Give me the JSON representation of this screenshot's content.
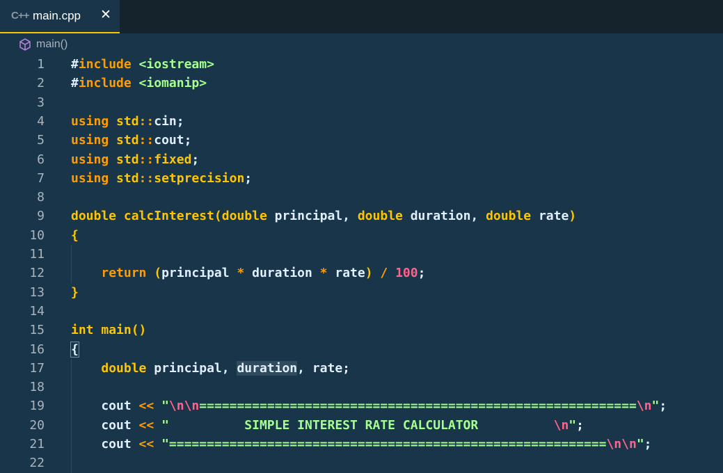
{
  "tab": {
    "icon": "cpp-file-icon",
    "icon_text": "C++",
    "label": "main.cpp",
    "close": "✕"
  },
  "breadcrumb": {
    "icon": "cube-icon",
    "label": "main()"
  },
  "colors": {
    "background": "#193549",
    "tabbar": "#15232d",
    "accent": "#ffc600",
    "keyword": "#ff9d00",
    "string": "#a5ff90",
    "escape": "#ff628c"
  },
  "editor": {
    "lines": [
      {
        "n": "1",
        "tokens": [
          [
            "pu",
            "#"
          ],
          [
            "kw",
            "include"
          ],
          [
            "pu",
            " "
          ],
          [
            "str",
            "<iostream>"
          ]
        ]
      },
      {
        "n": "2",
        "tokens": [
          [
            "pu",
            "#"
          ],
          [
            "kw",
            "include"
          ],
          [
            "pu",
            " "
          ],
          [
            "str",
            "<iomanip>"
          ]
        ]
      },
      {
        "n": "3",
        "tokens": []
      },
      {
        "n": "4",
        "tokens": [
          [
            "kw",
            "using"
          ],
          [
            "pu",
            " "
          ],
          [
            "ns",
            "std"
          ],
          [
            "op",
            "::"
          ],
          [
            "pu",
            "cin;"
          ]
        ]
      },
      {
        "n": "5",
        "tokens": [
          [
            "kw",
            "using"
          ],
          [
            "pu",
            " "
          ],
          [
            "ns",
            "std"
          ],
          [
            "op",
            "::"
          ],
          [
            "pu",
            "cout;"
          ]
        ]
      },
      {
        "n": "6",
        "tokens": [
          [
            "kw",
            "using"
          ],
          [
            "pu",
            " "
          ],
          [
            "ns",
            "std"
          ],
          [
            "op",
            "::"
          ],
          [
            "ns",
            "fixed"
          ],
          [
            "pu",
            ";"
          ]
        ]
      },
      {
        "n": "7",
        "tokens": [
          [
            "kw",
            "using"
          ],
          [
            "pu",
            " "
          ],
          [
            "ns",
            "std"
          ],
          [
            "op",
            "::"
          ],
          [
            "ns",
            "setprecision"
          ],
          [
            "pu",
            ";"
          ]
        ]
      },
      {
        "n": "8",
        "tokens": []
      },
      {
        "n": "9",
        "tokens": [
          [
            "ty",
            "double"
          ],
          [
            "pu",
            " "
          ],
          [
            "fn",
            "calcInterest"
          ],
          [
            "br",
            "("
          ],
          [
            "ty",
            "double"
          ],
          [
            "pu",
            " principal, "
          ],
          [
            "ty",
            "double"
          ],
          [
            "pu",
            " duration, "
          ],
          [
            "ty",
            "double"
          ],
          [
            "pu",
            " rate"
          ],
          [
            "br",
            ")"
          ]
        ]
      },
      {
        "n": "10",
        "tokens": [
          [
            "br",
            "{"
          ]
        ]
      },
      {
        "n": "11",
        "tokens": []
      },
      {
        "n": "12",
        "tokens": [
          [
            "pu",
            "    "
          ],
          [
            "kw",
            "return"
          ],
          [
            "pu",
            " "
          ],
          [
            "br",
            "("
          ],
          [
            "pu",
            "principal "
          ],
          [
            "op",
            "*"
          ],
          [
            "pu",
            " duration "
          ],
          [
            "op",
            "*"
          ],
          [
            "pu",
            " rate"
          ],
          [
            "br",
            ")"
          ],
          [
            "pu",
            " "
          ],
          [
            "op",
            "/"
          ],
          [
            "pu",
            " "
          ],
          [
            "num",
            "100"
          ],
          [
            "pu",
            ";"
          ]
        ]
      },
      {
        "n": "13",
        "tokens": [
          [
            "br",
            "}"
          ]
        ]
      },
      {
        "n": "14",
        "tokens": []
      },
      {
        "n": "15",
        "tokens": [
          [
            "ty",
            "int"
          ],
          [
            "pu",
            " "
          ],
          [
            "fn",
            "main"
          ],
          [
            "br",
            "()"
          ]
        ]
      },
      {
        "n": "16",
        "tokens": [
          [
            "brbox",
            "{"
          ]
        ]
      },
      {
        "n": "17",
        "tokens": [
          [
            "pu",
            "    "
          ],
          [
            "ty",
            "double"
          ],
          [
            "pu",
            " principal, "
          ],
          [
            "hl",
            "duration"
          ],
          [
            "pu",
            ", rate;"
          ]
        ]
      },
      {
        "n": "18",
        "tokens": []
      },
      {
        "n": "19",
        "tokens": [
          [
            "pu",
            "    cout "
          ],
          [
            "op",
            "<<"
          ],
          [
            "pu",
            " "
          ],
          [
            "str",
            "\""
          ],
          [
            "esc",
            "\\n\\n"
          ],
          [
            "str",
            "=========================================================="
          ],
          [
            "esc",
            "\\n"
          ],
          [
            "str",
            "\""
          ],
          [
            "pu",
            ";"
          ]
        ]
      },
      {
        "n": "20",
        "tokens": [
          [
            "pu",
            "    cout "
          ],
          [
            "op",
            "<<"
          ],
          [
            "pu",
            " "
          ],
          [
            "str",
            "\"          SIMPLE INTEREST RATE CALCULATOR          "
          ],
          [
            "esc",
            "\\n"
          ],
          [
            "str",
            "\""
          ],
          [
            "pu",
            ";"
          ]
        ]
      },
      {
        "n": "21",
        "tokens": [
          [
            "pu",
            "    cout "
          ],
          [
            "op",
            "<<"
          ],
          [
            "pu",
            " "
          ],
          [
            "str",
            "\"=========================================================="
          ],
          [
            "esc",
            "\\n\\n"
          ],
          [
            "str",
            "\""
          ],
          [
            "pu",
            ";"
          ]
        ]
      },
      {
        "n": "22",
        "tokens": []
      }
    ]
  }
}
